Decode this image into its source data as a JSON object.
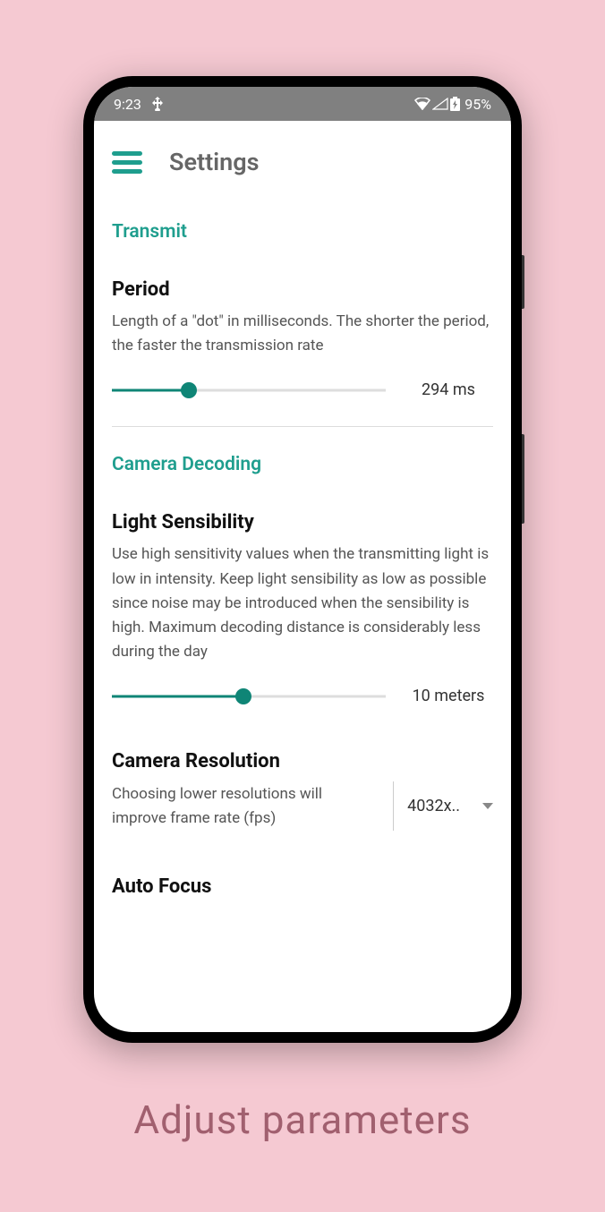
{
  "status_bar": {
    "time": "9:23",
    "battery_percent": "95%"
  },
  "header": {
    "title": "Settings"
  },
  "sections": {
    "transmit": {
      "header": "Transmit",
      "period": {
        "title": "Period",
        "description": "Length of a \"dot\" in milliseconds. The shorter the period, the faster the transmission rate",
        "value": "294 ms",
        "slider_percent": 28
      }
    },
    "camera_decoding": {
      "header": "Camera Decoding",
      "light_sensibility": {
        "title": "Light Sensibility",
        "description": "Use high sensitivity values when the transmitting light is low in intensity. Keep light sensibility as low as possible since noise may be introduced when the sensibility is high. Maximum decoding distance is considerably less during the day",
        "value": "10 meters",
        "slider_percent": 48
      },
      "camera_resolution": {
        "title": "Camera Resolution",
        "description": "Choosing lower resolutions will improve frame rate (fps)",
        "selected": "4032x.."
      },
      "auto_focus": {
        "title": "Auto Focus"
      }
    }
  },
  "caption": "Adjust parameters"
}
